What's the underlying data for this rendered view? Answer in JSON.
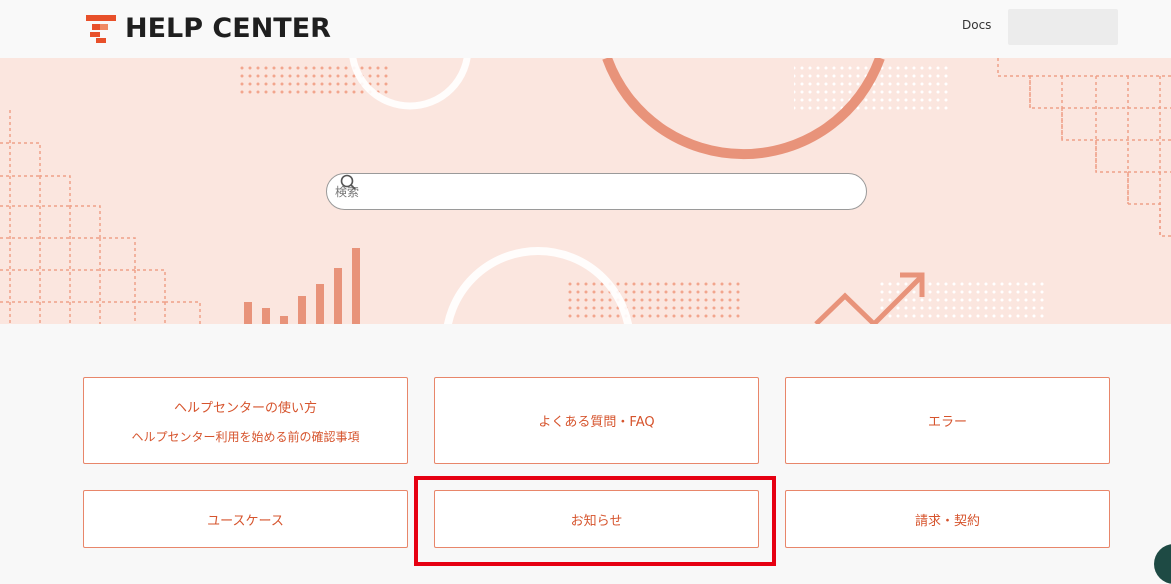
{
  "header": {
    "logo_text": "HELP CENTER",
    "docs_label": "Docs"
  },
  "search": {
    "placeholder": "検索"
  },
  "categories": [
    {
      "title": "ヘルプセンターの使い方",
      "subtitle": "ヘルプセンター利用を始める前の確認事項"
    },
    {
      "title": "よくある質問・FAQ"
    },
    {
      "title": "エラー"
    },
    {
      "title": "ユースケース"
    },
    {
      "title": "お知らせ"
    },
    {
      "title": "請求・契約"
    }
  ],
  "colors": {
    "accent": "#d6542d",
    "hero_bg": "#fbe6df",
    "highlight": "#e60012",
    "deco": "#e88d6e"
  }
}
